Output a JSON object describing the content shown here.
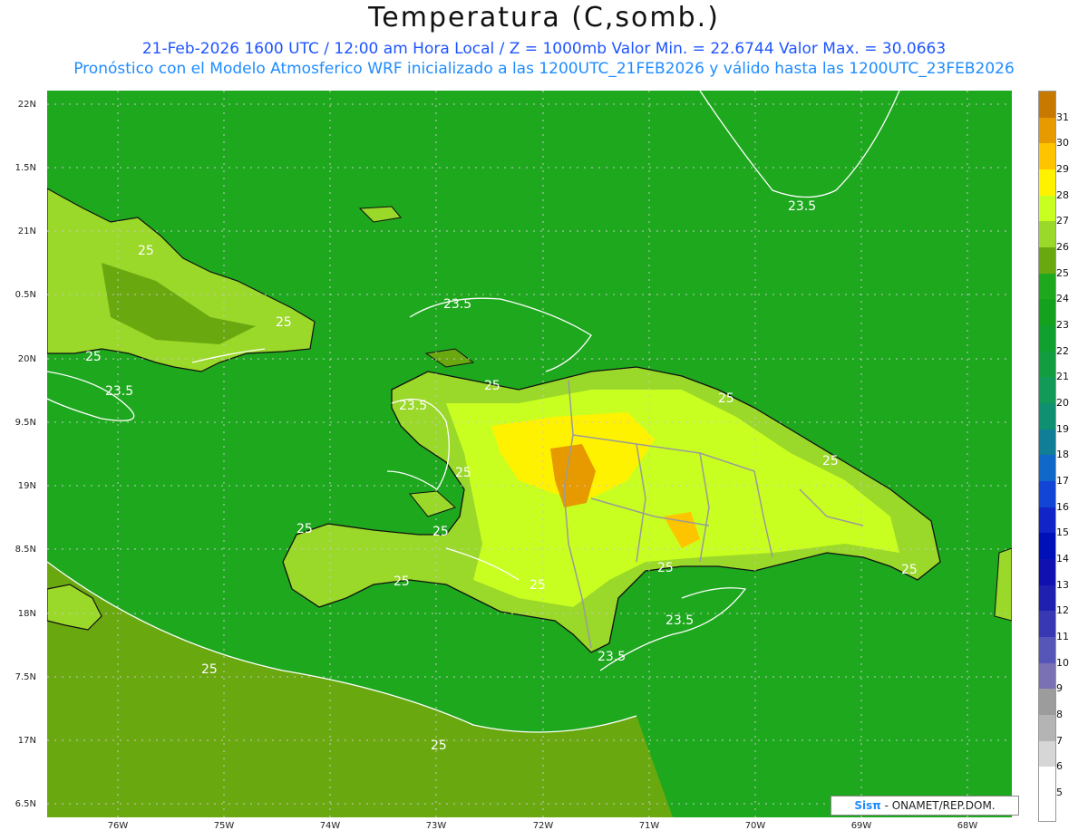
{
  "header": {
    "title": "Temperatura (C,somb.)",
    "line1": "21-Feb-2026 1600 UTC / 12:00 am Hora Local / Z = 1000mb  Valor Min. = 22.6744  Valor Max. = 30.0663",
    "line2": "Pronóstico con el Modelo Atmosferico WRF inicializado a las 1200UTC_21FEB2026 y válido hasta las  1200UTC_23FEB2026"
  },
  "axes": {
    "lat_labels": [
      "22N",
      "1.5N",
      "21N",
      "0.5N",
      "20N",
      "9.5N",
      "19N",
      "8.5N",
      "18N",
      "7.5N",
      "17N",
      "6.5N"
    ],
    "lon_labels": [
      "76W",
      "75W",
      "74W",
      "73W",
      "72W",
      "71W",
      "70W",
      "69W",
      "68W"
    ]
  },
  "colorbar": {
    "labels": [
      "31",
      "30",
      "29",
      "28",
      "27",
      "26",
      "25",
      "24",
      "23",
      "22",
      "21",
      "20",
      "19",
      "18",
      "17",
      "16",
      "15",
      "14",
      "13",
      "12",
      "11",
      "10",
      "9",
      "8",
      "7",
      "6",
      "5"
    ],
    "colors": [
      "#c87a00",
      "#e69a00",
      "#ffc400",
      "#fff200",
      "#c8ff20",
      "#9ad82a",
      "#6aa810",
      "#1ea81e",
      "#14a21e",
      "#10a030",
      "#129d40",
      "#129a58",
      "#0f9070",
      "#0f7e96",
      "#1068c8",
      "#1244d6",
      "#1024c8",
      "#0010b8",
      "#1010b0",
      "#2020b0",
      "#3838b4",
      "#5656b8",
      "#7a70b4",
      "#9c9c9c",
      "#b4b4b4",
      "#d6d6d6",
      "#ffffff"
    ]
  },
  "contour_labels": [
    "23.5",
    "23.5",
    "23.5",
    "23.5",
    "23.5",
    "23.5",
    "25",
    "25",
    "25",
    "25",
    "25",
    "25",
    "25",
    "25",
    "25",
    "25",
    "25",
    "25",
    "25",
    "25",
    "25"
  ],
  "credit": {
    "brand": "Sisπ",
    "text": " - ONAMET/REP.DOM."
  },
  "colors": {
    "sea": "#1ea81e",
    "land_low": "#6aa810",
    "land_mid": "#9ad82a",
    "land_high": "#fff200",
    "land_peak": "#e69a00",
    "title_blue": "#1e55ff",
    "subtitle_blue": "#1e8cff"
  }
}
